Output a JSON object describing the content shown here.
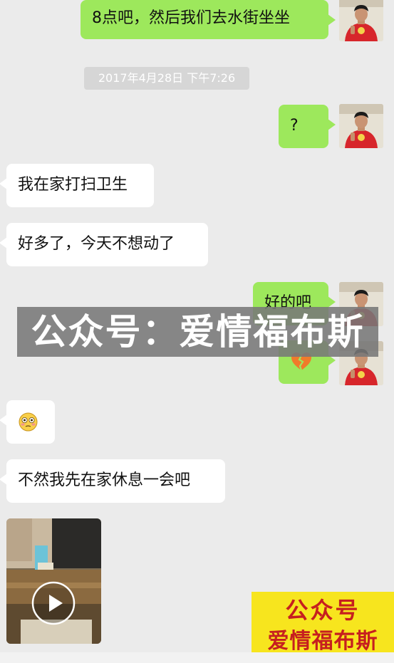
{
  "chat": {
    "timestamp": "2017年4月28日 下午7:26",
    "messages": [
      {
        "from": "me",
        "text": "8点吧，然后我们去水街坐坐"
      },
      {
        "from": "me",
        "text": "?"
      },
      {
        "from": "them",
        "text": "我在家打扫卫生"
      },
      {
        "from": "them",
        "text": "好多了，今天不想动了"
      },
      {
        "from": "me",
        "text": "好的吧"
      },
      {
        "from": "me",
        "emoji": "broken-heart-icon"
      },
      {
        "from": "them",
        "emoji": "flushed-face-icon"
      },
      {
        "from": "them",
        "text": "不然我先在家休息一会吧"
      },
      {
        "from": "them",
        "type": "video"
      }
    ]
  },
  "watermark": {
    "banner_text": "公众号：爱情福布斯",
    "corner_line1": "公众号",
    "corner_line2": "爱情福布斯"
  },
  "colors": {
    "background": "#ebebeb",
    "me_bubble": "#9de85c",
    "them_bubble": "#ffffff",
    "corner_bg": "#f7e51e",
    "corner_text": "#c61f1f"
  }
}
